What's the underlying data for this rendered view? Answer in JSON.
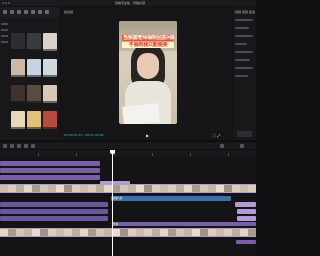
{
  "window": {
    "title": "剪映专业版 - 草稿标题"
  },
  "player": {
    "label": "播放器",
    "overlay_line1": "当我被老师抽到回答问题",
    "overlay_line2": "不会的我只能装哭",
    "timecode": "00:00:05:12 / 00:01:32:06",
    "play_icon": "play-icon",
    "controls_text": "⛶ ⤢"
  },
  "props": {
    "title": "视频 音频 变速"
  },
  "media": {
    "thumbnails": [
      {
        "color": "#2d2d31"
      },
      {
        "color": "#3a3a3f"
      },
      {
        "color": "#d8d2c8"
      },
      {
        "color": "#cbb9a8"
      },
      {
        "color": "#c9d2e4"
      },
      {
        "color": "#cfd8df"
      },
      {
        "color": "#3d3230"
      },
      {
        "color": "#5b4a42"
      },
      {
        "color": "#d7c9b5"
      },
      {
        "color": "#e7d8b8"
      },
      {
        "color": "#e2c27a"
      },
      {
        "color": "#b74a3c"
      }
    ]
  },
  "timeline": {
    "clip_label": "视频片段",
    "clip_label2": "文本",
    "colors": {
      "purple": "#7b5ea8",
      "lavender": "#b49bd8",
      "blue": "#3f6fa8",
      "accent": "#25c4d6"
    }
  }
}
